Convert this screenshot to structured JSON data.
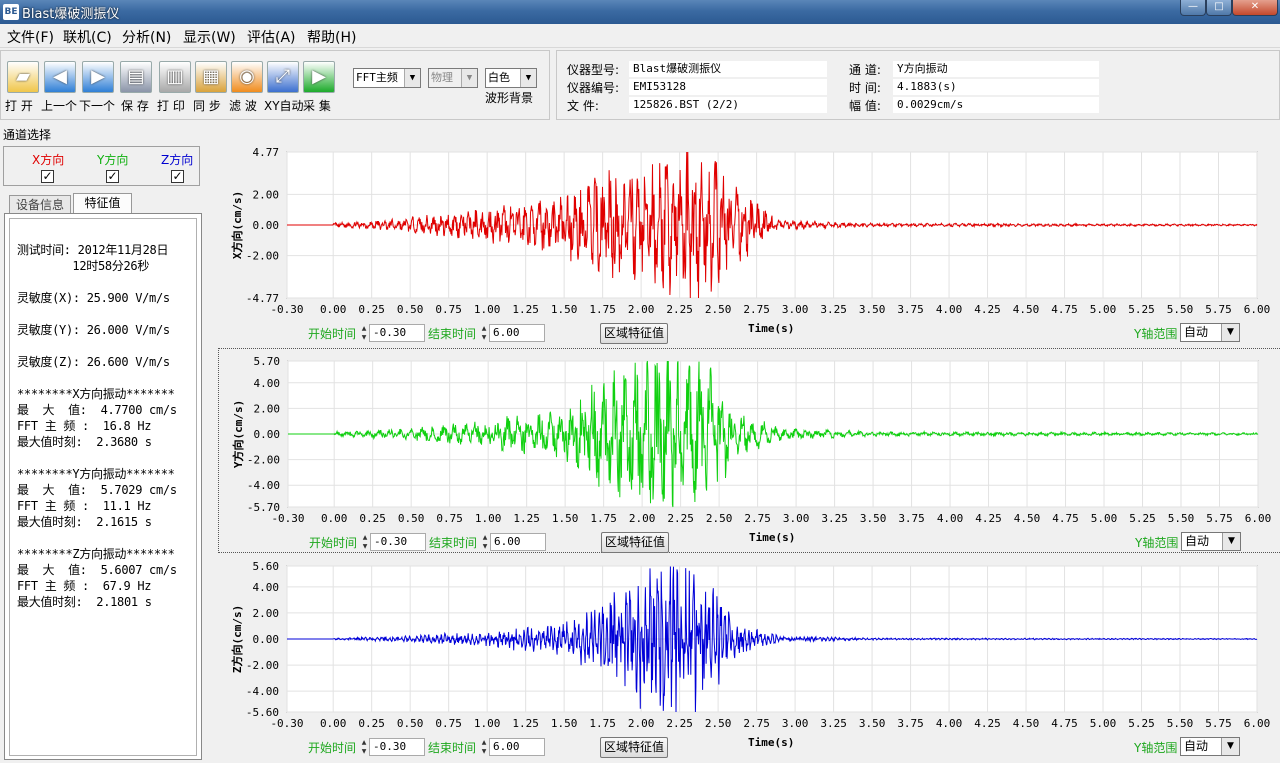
{
  "window": {
    "title": "Blast爆破测振仪",
    "icon_text": "BE",
    "min": "—",
    "max": "□",
    "close": "✕"
  },
  "menu": [
    "文件(F)",
    "联机(C)",
    "分析(N)",
    "显示(W)",
    "评估(A)",
    "帮助(H)"
  ],
  "toolbar": {
    "buttons": [
      {
        "label": "打 开",
        "icon": "folder-icon",
        "color": "#f0c64a"
      },
      {
        "label": "上一个",
        "icon": "arrow-left-icon",
        "color": "#2f7fd6"
      },
      {
        "label": "下一个",
        "icon": "arrow-right-icon",
        "color": "#2f7fd6"
      },
      {
        "label": "保 存",
        "icon": "save-icon",
        "color": "#8a94a8"
      },
      {
        "label": "打 印",
        "icon": "printer-icon",
        "color": "#a8a8a8"
      },
      {
        "label": "同 步",
        "icon": "sync-icon",
        "color": "#d9a23b"
      },
      {
        "label": "滤 波",
        "icon": "filter-icon",
        "color": "#f08c1e"
      },
      {
        "label": "XY自动",
        "icon": "xy-auto-icon",
        "color": "#3b6fcf"
      },
      {
        "label": "采 集",
        "icon": "play-icon",
        "color": "#1caa2a"
      }
    ],
    "fft_select": "FFT主频",
    "phys_select": "物理",
    "bg_select": "白色",
    "bg_label": "波形背景"
  },
  "info": {
    "model_label": "仪器型号:",
    "model": "Blast爆破测振仪",
    "serial_label": "仪器编号:",
    "serial": "EMI53128",
    "file_label": "文    件:",
    "file": "125826.BST  (2/2)",
    "channel_label": "通  道:",
    "channel": "Y方向振动",
    "time_label": "时  间:",
    "time": "4.1883(s)",
    "amp_label": "幅  值:",
    "amp": "0.0029cm/s"
  },
  "channel_select": {
    "title": "通道选择",
    "channels": [
      {
        "label": "X方向",
        "checked": "✓",
        "color": "#e00000"
      },
      {
        "label": "Y方向",
        "checked": "✓",
        "color": "#10b010"
      },
      {
        "label": "Z方向",
        "checked": "✓",
        "color": "#0000d0"
      }
    ]
  },
  "tabs": {
    "device": "设备信息",
    "features": "特征值"
  },
  "features": {
    "test_time_1": "测试时间: 2012年11月28日",
    "test_time_2": "        12时58分26秒",
    "sens_x": "灵敏度(X): 25.900 V/m/s",
    "sens_y": "灵敏度(Y): 26.000 V/m/s",
    "sens_z": "灵敏度(Z): 26.600 V/m/s",
    "x_head": "********X方向振动*******",
    "x_max": "最  大  值:  4.7700 cm/s",
    "x_fft": "FFT 主 频 :  16.8 Hz",
    "x_time": "最大值时刻:  2.3680 s",
    "y_head": "********Y方向振动*******",
    "y_max": "最  大  值:  5.7029 cm/s",
    "y_fft": "FFT 主 频 :  11.1 Hz",
    "y_time": "最大值时刻:  2.1615 s",
    "z_head": "********Z方向振动*******",
    "z_max": "最  大  值:  5.6007 cm/s",
    "z_fft": "FFT 主 频 :  67.9 Hz",
    "z_time": "最大值时刻:  2.1801 s"
  },
  "controls": {
    "start_label": "开始时间",
    "start_value": "-0.30",
    "end_label": "结束时间",
    "end_value": "6.00",
    "region_button": "区域特征值",
    "time_axis_label": "Time(s)",
    "yrange_label": "Y轴范围",
    "yrange_value": "自动"
  },
  "chart_data": [
    {
      "type": "line",
      "ylabel": "X方向(cm/s)",
      "xlim": [
        -0.3,
        6.0
      ],
      "ylim": [
        -4.77,
        4.77
      ],
      "yticks": [
        "4.77",
        "2.00",
        "0.00",
        "-2.00",
        "-4.77"
      ],
      "xticks": [
        "-0.30",
        "0.00",
        "0.25",
        "0.50",
        "0.75",
        "1.00",
        "1.25",
        "1.50",
        "1.75",
        "2.00",
        "2.25",
        "2.50",
        "2.75",
        "3.00",
        "3.25",
        "3.50",
        "3.75",
        "4.00",
        "4.25",
        "4.50",
        "4.75",
        "5.00",
        "5.25",
        "5.50",
        "5.75",
        "6.00"
      ],
      "color": "#e00000",
      "grid": true,
      "envelope": {
        "t": [
          0.0,
          0.5,
          1.0,
          1.5,
          1.75,
          2.0,
          2.37,
          2.6,
          2.9,
          3.5,
          6.0
        ],
        "amp": [
          0.1,
          0.4,
          0.9,
          1.6,
          3.2,
          2.8,
          4.77,
          2.2,
          0.3,
          0.1,
          0.05
        ]
      },
      "dominant_hz": 16.8
    },
    {
      "type": "line",
      "ylabel": "Y方向(cm/s)",
      "xlim": [
        -0.3,
        6.0
      ],
      "ylim": [
        -5.7,
        5.7
      ],
      "yticks": [
        "5.70",
        "4.00",
        "2.00",
        "0.00",
        "-2.00",
        "-4.00",
        "-5.70"
      ],
      "xticks": [
        "-0.30",
        "0.00",
        "0.25",
        "0.50",
        "0.75",
        "1.00",
        "1.25",
        "1.50",
        "1.75",
        "2.00",
        "2.25",
        "2.50",
        "2.75",
        "3.00",
        "3.25",
        "3.50",
        "3.75",
        "4.00",
        "4.25",
        "4.50",
        "4.75",
        "5.00",
        "5.25",
        "5.50",
        "5.75",
        "6.00"
      ],
      "color": "#10d010",
      "grid": true,
      "envelope": {
        "t": [
          0.0,
          0.5,
          1.0,
          1.5,
          1.75,
          2.16,
          2.5,
          2.6,
          2.9,
          3.5,
          6.0
        ],
        "amp": [
          0.15,
          0.4,
          0.9,
          1.7,
          4.0,
          5.7,
          3.8,
          1.6,
          0.4,
          0.15,
          0.08
        ]
      },
      "dominant_hz": 11.1
    },
    {
      "type": "line",
      "ylabel": "Z方向(cm/s)",
      "xlim": [
        -0.3,
        6.0
      ],
      "ylim": [
        -5.6,
        5.6
      ],
      "yticks": [
        "5.60",
        "4.00",
        "2.00",
        "0.00",
        "-2.00",
        "-4.00",
        "-5.60"
      ],
      "xticks": [
        "-0.30",
        "0.00",
        "0.25",
        "0.50",
        "0.75",
        "1.00",
        "1.25",
        "1.50",
        "1.75",
        "2.00",
        "2.25",
        "2.50",
        "2.75",
        "3.00",
        "3.25",
        "3.50",
        "3.75",
        "4.00",
        "4.25",
        "4.50",
        "4.75",
        "5.00",
        "5.25",
        "5.50",
        "5.75",
        "6.00"
      ],
      "color": "#0000d8",
      "grid": true,
      "envelope": {
        "t": [
          0.0,
          0.5,
          1.0,
          1.5,
          1.75,
          2.18,
          2.45,
          2.6,
          2.9,
          3.5,
          6.0
        ],
        "amp": [
          0.05,
          0.2,
          0.5,
          1.0,
          2.5,
          5.6,
          3.8,
          1.2,
          0.2,
          0.06,
          0.03
        ]
      },
      "dominant_hz": 67.9
    }
  ]
}
